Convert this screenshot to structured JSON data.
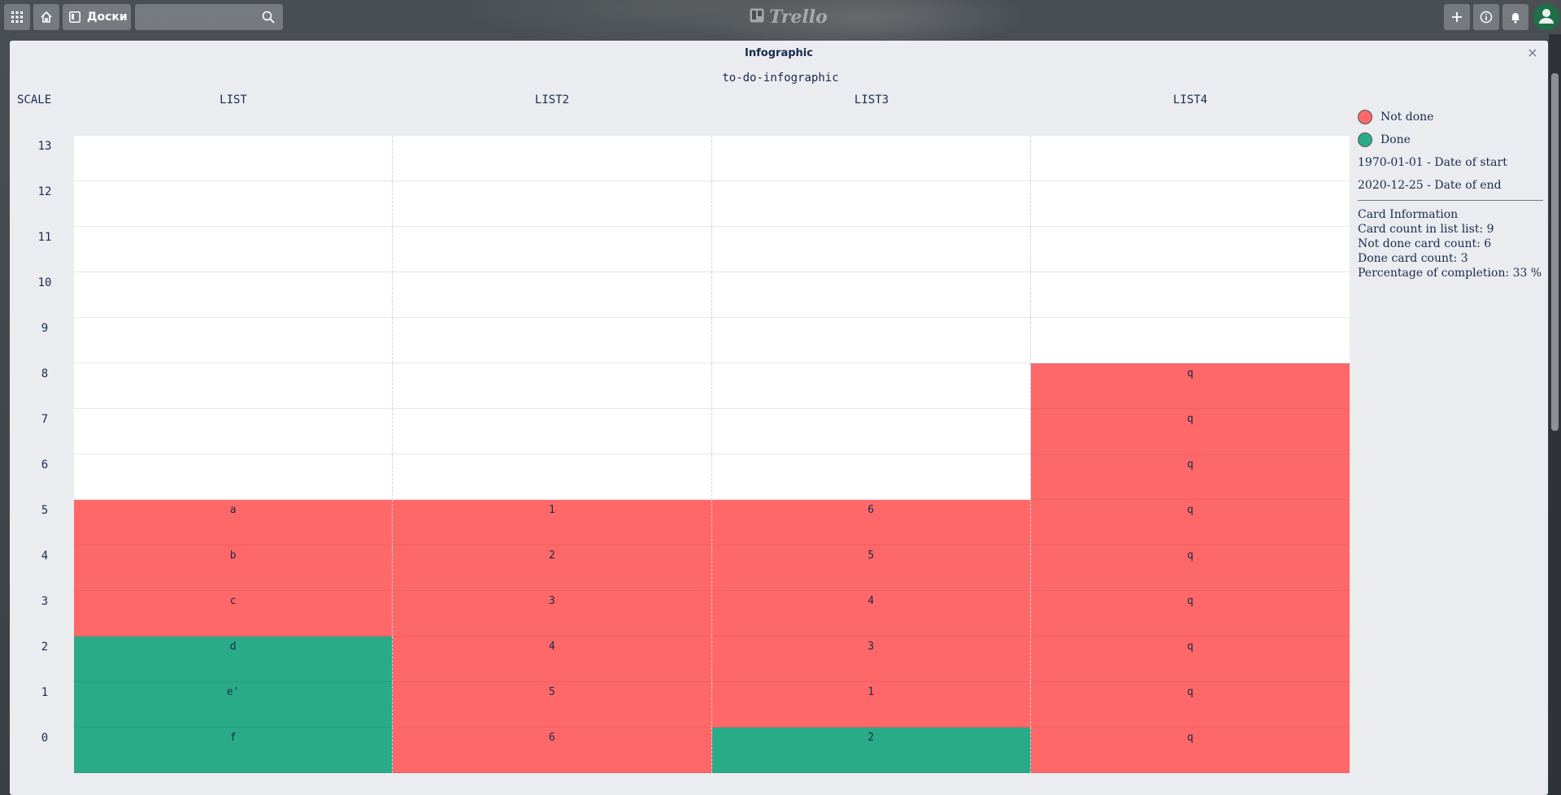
{
  "header": {
    "boards_label": "Доски",
    "search_placeholder": "",
    "logo_text": "Trello"
  },
  "modal": {
    "title": "Infographic",
    "close_symbol": "×"
  },
  "infographic": {
    "title": "to-do-infographic",
    "scale_label": "SCALE",
    "lists": [
      "LIST",
      "LIST2",
      "LIST3",
      "LIST4"
    ],
    "scale": [
      13,
      12,
      11,
      10,
      9,
      8,
      7,
      6,
      5,
      4,
      3,
      2,
      1,
      0
    ],
    "columns": [
      {
        "name": "LIST",
        "cards": [
          {
            "label": "f",
            "status": "done"
          },
          {
            "label": "e'",
            "status": "done"
          },
          {
            "label": "d",
            "status": "done"
          },
          {
            "label": "c",
            "status": "not-done"
          },
          {
            "label": "b",
            "status": "not-done"
          },
          {
            "label": "a",
            "status": "not-done"
          }
        ]
      },
      {
        "name": "LIST2",
        "cards": [
          {
            "label": "6",
            "status": "not-done"
          },
          {
            "label": "5",
            "status": "not-done"
          },
          {
            "label": "4",
            "status": "not-done"
          },
          {
            "label": "3",
            "status": "not-done"
          },
          {
            "label": "2",
            "status": "not-done"
          },
          {
            "label": "1",
            "status": "not-done"
          }
        ]
      },
      {
        "name": "LIST3",
        "cards": [
          {
            "label": "2",
            "status": "done"
          },
          {
            "label": "1",
            "status": "not-done"
          },
          {
            "label": "3",
            "status": "not-done"
          },
          {
            "label": "4",
            "status": "not-done"
          },
          {
            "label": "5",
            "status": "not-done"
          },
          {
            "label": "6",
            "status": "not-done"
          }
        ]
      },
      {
        "name": "LIST4",
        "cards": [
          {
            "label": "q",
            "status": "not-done"
          },
          {
            "label": "q",
            "status": "not-done"
          },
          {
            "label": "q",
            "status": "not-done"
          },
          {
            "label": "q",
            "status": "not-done"
          },
          {
            "label": "q",
            "status": "not-done"
          },
          {
            "label": "q",
            "status": "not-done"
          },
          {
            "label": "q",
            "status": "not-done"
          },
          {
            "label": "q",
            "status": "not-done"
          },
          {
            "label": "q",
            "status": "not-done"
          }
        ]
      }
    ]
  },
  "legend": {
    "not_done_label": "Not done",
    "done_label": "Done",
    "not_done_color": "#ff6868",
    "done_color": "#2aab87",
    "start_date": "1970-01-01 - Date of start",
    "end_date": "2020-12-25 - Date of end",
    "card_info_title": "Card Information",
    "card_count": "Card count in list list: 9",
    "not_done_count": "Not done card count: 6",
    "done_count": "Done card count: 3",
    "completion": "Percentage of completion: 33 %"
  }
}
